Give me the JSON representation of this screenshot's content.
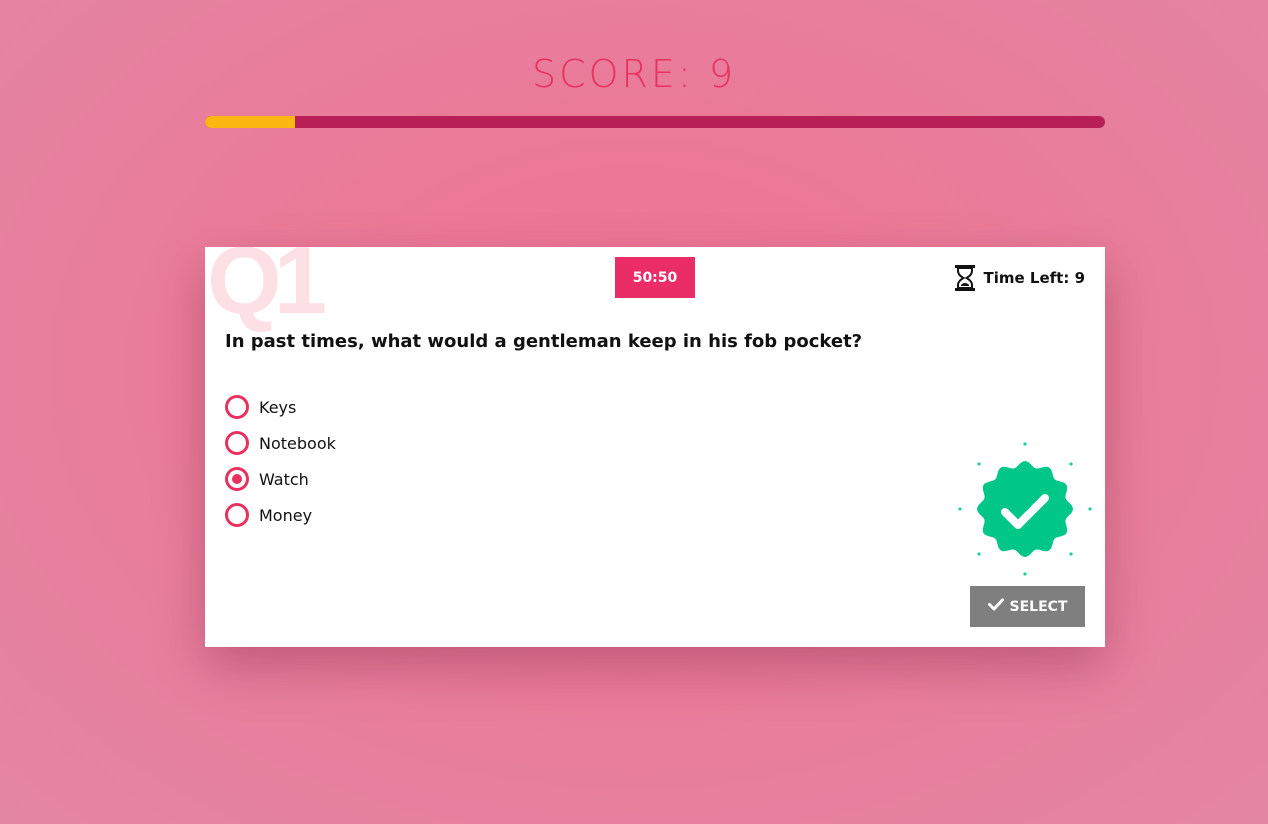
{
  "score": {
    "label": "SCORE: 9"
  },
  "progress": {
    "fraction": 0.1,
    "fill_color": "#fdb713",
    "track_color": "#b91f57"
  },
  "card": {
    "question_number": "Q1",
    "lifeline_label": "50:50",
    "timer": {
      "icon": "hourglass-icon",
      "text": "Time Left: 9"
    },
    "question": "In past times, what would a gentleman keep in his fob pocket?",
    "options": [
      {
        "label": "Keys",
        "selected": false
      },
      {
        "label": "Notebook",
        "selected": false
      },
      {
        "label": "Watch",
        "selected": true
      },
      {
        "label": "Money",
        "selected": false
      }
    ],
    "result_icon": "check-badge-icon",
    "select_button": {
      "icon": "check-icon",
      "label": "SELECT"
    }
  },
  "colors": {
    "accent": "#e8315f",
    "lifeline_bg": "#ea2d66",
    "badge_green": "#00c785",
    "button_gray": "#7f7f7f"
  }
}
